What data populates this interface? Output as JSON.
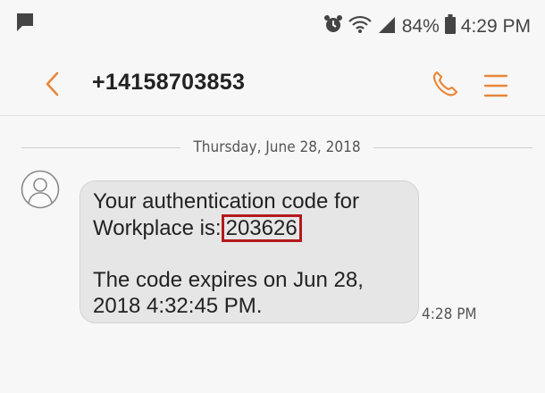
{
  "status_bar": {
    "battery": "84%",
    "time": "4:29 PM",
    "icons": [
      "message-notification-icon",
      "alarm-icon",
      "wifi-icon",
      "cell-signal-icon",
      "battery-icon"
    ]
  },
  "header": {
    "title": "+14158703853",
    "accent_color": "#e8873a"
  },
  "conversation": {
    "date": "Thursday, June 28, 2018",
    "messages": [
      {
        "line1": "Your authentication code for",
        "line2_prefix": "Workplace is:",
        "code": "203626",
        "line3": "The code expires on Jun 28,",
        "line4": "2018 4:32:45 PM.",
        "time": "4:28 PM"
      }
    ]
  }
}
